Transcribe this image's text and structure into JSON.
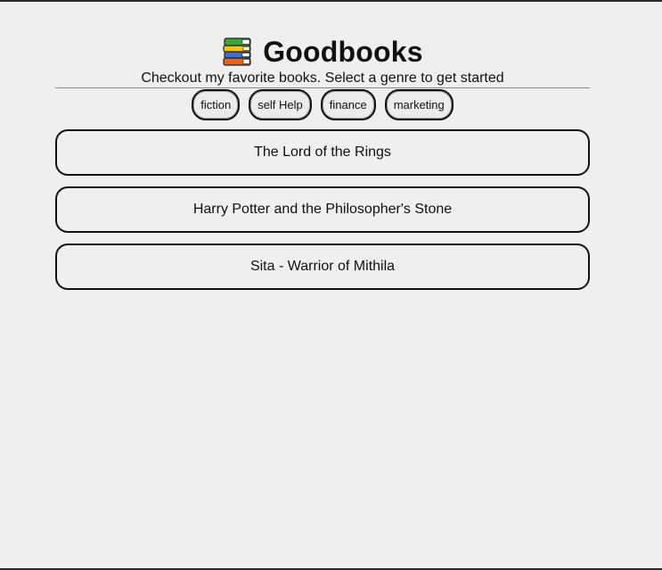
{
  "header": {
    "title": "Goodbooks",
    "subtitle": "Checkout my favorite books. Select a genre to get started",
    "icon": "books-icon"
  },
  "genres": [
    {
      "label": "fiction"
    },
    {
      "label": "self Help"
    },
    {
      "label": "finance"
    },
    {
      "label": "marketing"
    }
  ],
  "books": [
    {
      "title": "The Lord of the Rings"
    },
    {
      "title": "Harry Potter and the Philosopher's Stone"
    },
    {
      "title": "Sita - Warrior of Mithila"
    }
  ],
  "colors": {
    "background": "#efefef",
    "border": "#111111",
    "divider": "#8a8a8a"
  }
}
